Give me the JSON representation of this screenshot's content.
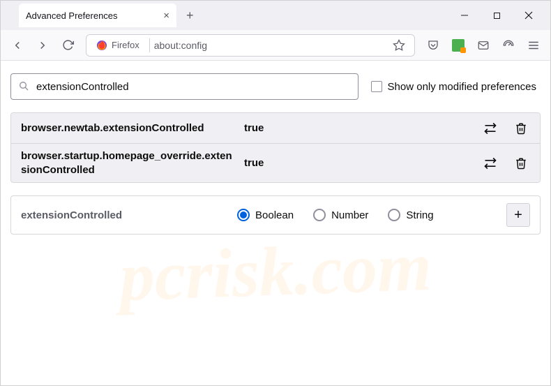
{
  "tab": {
    "title": "Advanced Preferences"
  },
  "urlbar": {
    "identity": "Firefox",
    "url": "about:config"
  },
  "search": {
    "value": "extensionControlled",
    "checkbox_label": "Show only modified preferences"
  },
  "prefs": [
    {
      "name": "browser.newtab.extensionControlled",
      "value": "true"
    },
    {
      "name": "browser.startup.homepage_override.extensionControlled",
      "value": "true"
    }
  ],
  "create": {
    "name": "extensionControlled",
    "types": [
      "Boolean",
      "Number",
      "String"
    ],
    "selected": 0
  },
  "watermark": "pcrisk.com"
}
